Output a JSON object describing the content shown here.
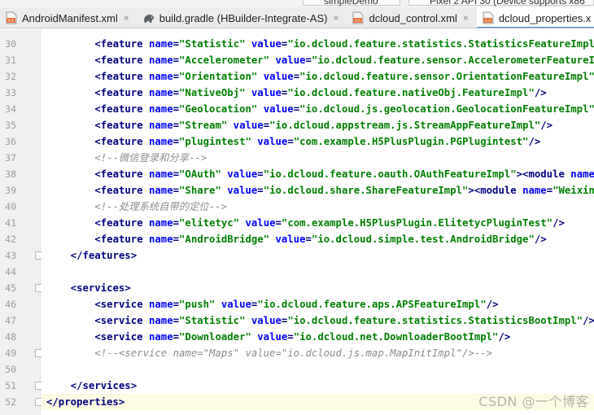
{
  "toolbar": {
    "run_config": "simpleDemo",
    "device": "Pixel 2 API 30 (Device supports x86"
  },
  "tabs": [
    {
      "label": "AndroidManifest.xml",
      "icon": "xml-file-icon",
      "active": false
    },
    {
      "label": "build.gradle (HBuilder-Integrate-AS)",
      "icon": "gradle-elephant-icon",
      "active": false
    },
    {
      "label": "dcloud_control.xml",
      "icon": "xml-file-icon",
      "active": false
    },
    {
      "label": "dcloud_properties.x",
      "icon": "xml-file-icon",
      "active": true
    }
  ],
  "code_lines": [
    {
      "n": "30",
      "indent": 8,
      "kind": "feature",
      "name": "Statistic",
      "value": "io.dcloud.feature.statistics.StatisticsFeatureImpl",
      "suffix": "/>"
    },
    {
      "n": "31",
      "indent": 8,
      "kind": "feature",
      "name": "Accelerometer",
      "value": "io.dcloud.feature.sensor.AccelerometerFeatureImpl",
      "suffix": "/>"
    },
    {
      "n": "32",
      "indent": 8,
      "kind": "feature",
      "name": "Orientation",
      "value": "io.dcloud.feature.sensor.OrientationFeatureImpl",
      "suffix": "/>"
    },
    {
      "n": "33",
      "indent": 8,
      "kind": "feature",
      "name": "NativeObj",
      "value": "io.dcloud.feature.nativeObj.FeatureImpl",
      "suffix": "/>"
    },
    {
      "n": "34",
      "indent": 8,
      "kind": "feature",
      "name": "Geolocation",
      "value": "io.dcloud.js.geolocation.GeolocationFeatureImpl",
      "suffix": "/>"
    },
    {
      "n": "35",
      "indent": 8,
      "kind": "feature",
      "name": "Stream",
      "value": "io.dcloud.appstream.js.StreamAppFeatureImpl",
      "suffix": "/>"
    },
    {
      "n": "36",
      "indent": 8,
      "kind": "feature",
      "name": "plugintest",
      "value": "com.example.H5PlusPlugin.PGPlugintest",
      "suffix": "/>"
    },
    {
      "n": "37",
      "indent": 8,
      "kind": "comment",
      "text": "<!--微信登录和分享-->"
    },
    {
      "n": "38",
      "indent": 8,
      "kind": "feature",
      "name": "OAuth",
      "value": "io.dcloud.feature.oauth.OAuthFeatureImpl",
      "suffix": "><module",
      "extra_attr": "name",
      "extra_val": "OAut"
    },
    {
      "n": "39",
      "indent": 8,
      "kind": "feature",
      "name": "Share",
      "value": "io.dcloud.share.ShareFeatureImpl",
      "suffix": "><module",
      "extra_attr": "name",
      "extra_val": "Weixin",
      "extra_tail": "val"
    },
    {
      "n": "40",
      "indent": 8,
      "kind": "comment",
      "text": "<!--处理系统自带的定位-->"
    },
    {
      "n": "41",
      "indent": 8,
      "kind": "feature",
      "name": "elitetyc",
      "value": "com.example.H5PlusPlugin.ElitetycPluginTest",
      "suffix": "/>"
    },
    {
      "n": "42",
      "indent": 8,
      "kind": "feature",
      "name": "AndroidBridge",
      "value": "io.dcloud.simple.test.AndroidBridge",
      "suffix": "/>"
    },
    {
      "n": "43",
      "indent": 4,
      "kind": "close",
      "text": "</features>"
    },
    {
      "n": "44",
      "indent": 0,
      "kind": "blank"
    },
    {
      "n": "45",
      "indent": 4,
      "kind": "open",
      "text": "<services>"
    },
    {
      "n": "46",
      "indent": 8,
      "kind": "service",
      "name": "push",
      "value": "io.dcloud.feature.aps.APSFeatureImpl",
      "suffix": "/>"
    },
    {
      "n": "47",
      "indent": 8,
      "kind": "service",
      "name": "Statistic",
      "value": "io.dcloud.feature.statistics.StatisticsBootImpl",
      "suffix": "/>"
    },
    {
      "n": "48",
      "indent": 8,
      "kind": "service",
      "name": "Downloader",
      "value": "io.dcloud.net.DownloaderBootImpl",
      "suffix": "/>"
    },
    {
      "n": "49",
      "indent": 8,
      "kind": "comment",
      "text": "<!--<service name=\"Maps\" value=\"io.dcloud.js.map.MapInitImpl\"/>-->"
    },
    {
      "n": "50",
      "indent": 0,
      "kind": "blank"
    },
    {
      "n": "51",
      "indent": 4,
      "kind": "close",
      "text": "</services>"
    },
    {
      "n": "52",
      "indent": 0,
      "kind": "close",
      "text": "</properties>"
    }
  ],
  "fold_lines": [
    "43",
    "45",
    "49",
    "51",
    "52"
  ],
  "watermark": "CSDN @一个博客",
  "colors": {
    "tag": "#000080",
    "attribute": "#0000ff",
    "value": "#008000",
    "comment": "#8c8c8c",
    "active_tab_underline": "#4083c9"
  }
}
